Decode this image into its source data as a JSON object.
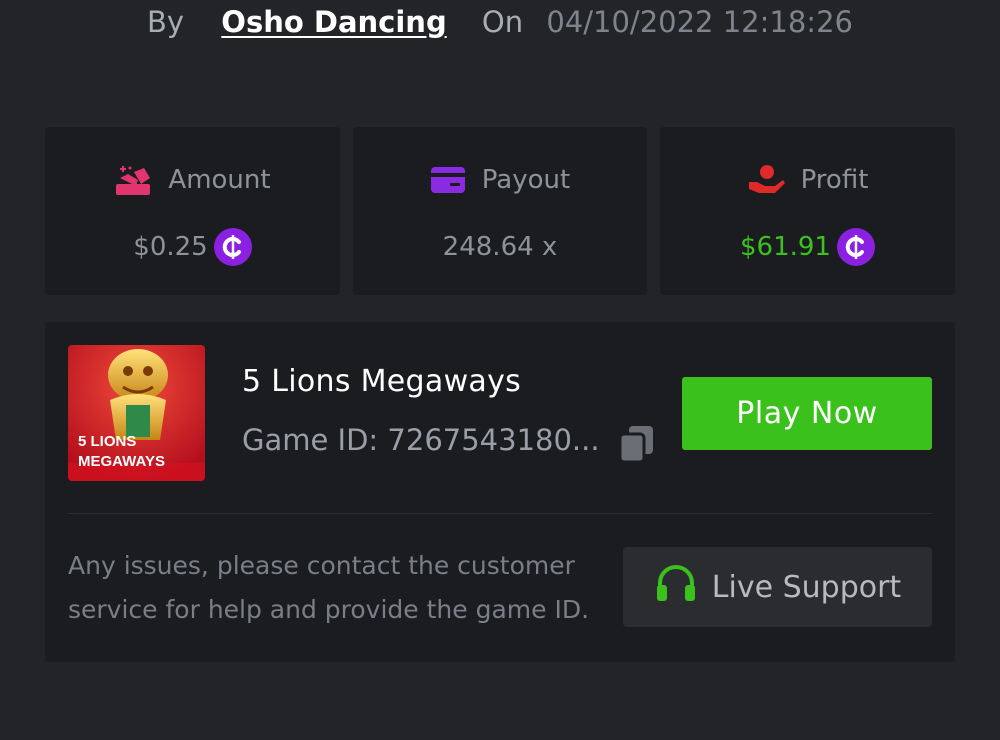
{
  "header": {
    "by_label": "By",
    "author": "Osho Dancing",
    "on_label": "On",
    "timestamp": "04/10/2022 12:18:26"
  },
  "stats": {
    "amount": {
      "label": "Amount",
      "value": "$0.25",
      "icon": "coins-hand-icon",
      "currency_icon": "coin-icon"
    },
    "payout": {
      "label": "Payout",
      "value": "248.64 x",
      "icon": "credit-card-icon"
    },
    "profit": {
      "label": "Profit",
      "value": "$61.91",
      "icon": "hand-profit-icon",
      "currency_icon": "coin-icon"
    }
  },
  "game": {
    "title": "5 Lions Megaways",
    "id_text": "Game ID: 7267543180...",
    "thumb_text_line1": "5 LIONS",
    "thumb_text_line2": "MEGAWAYS",
    "play_label": "Play Now"
  },
  "support": {
    "help_text": "Any issues, please contact the customer service for help and provide the game ID.",
    "button_label": "Live Support"
  },
  "colors": {
    "background": "#232427",
    "card": "#1b1c1f",
    "accent_green": "#3bc11c",
    "coin_purple": "#8a21e0",
    "amount_pink": "#e0356d",
    "payout_purple": "#8a2be2",
    "profit_red": "#e02a2a"
  }
}
